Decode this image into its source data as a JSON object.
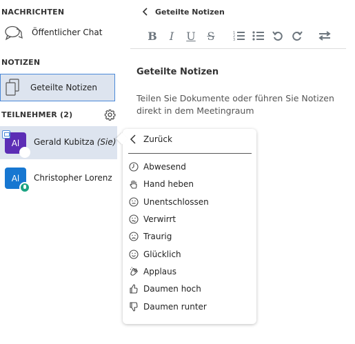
{
  "sidebar": {
    "messages_header": "NACHRICHTEN",
    "public_chat_label": "Öffentlicher Chat",
    "notes_header": "NOTIZEN",
    "shared_notes_label": "Geteilte Notizen",
    "participants_header": "TEILNEHMER (2)",
    "users": [
      {
        "initials": "Al",
        "name": "Gerald Kubitza",
        "suffix": "(Sie)",
        "color": "#5c2db5"
      },
      {
        "initials": "Al",
        "name": "Christopher Lorenz",
        "suffix": "",
        "color": "#1777d1"
      }
    ]
  },
  "notes_panel": {
    "back_label": "Geteilte Notizen",
    "title": "Geteilte Notizen",
    "description_line1": "Teilen Sie Dokumente oder führen Sie Notizen",
    "description_line2": "direkt in dem Meetingraum"
  },
  "status_menu": {
    "back_label": "Zurück",
    "items": [
      {
        "label": "Abwesend",
        "icon": "clock-icon"
      },
      {
        "label": "Hand heben",
        "icon": "hand-icon"
      },
      {
        "label": "Unentschlossen",
        "icon": "neutral-face-icon"
      },
      {
        "label": "Verwirrt",
        "icon": "confused-face-icon"
      },
      {
        "label": "Traurig",
        "icon": "sad-face-icon"
      },
      {
        "label": "Glücklich",
        "icon": "happy-face-icon"
      },
      {
        "label": "Applaus",
        "icon": "applause-icon"
      },
      {
        "label": "Daumen hoch",
        "icon": "thumbs-up-icon"
      },
      {
        "label": "Daumen runter",
        "icon": "thumbs-down-icon"
      }
    ]
  },
  "colors": {
    "accent": "#4a88d8",
    "selected_bg": "#dde4ef",
    "talking": "#1aa382"
  }
}
